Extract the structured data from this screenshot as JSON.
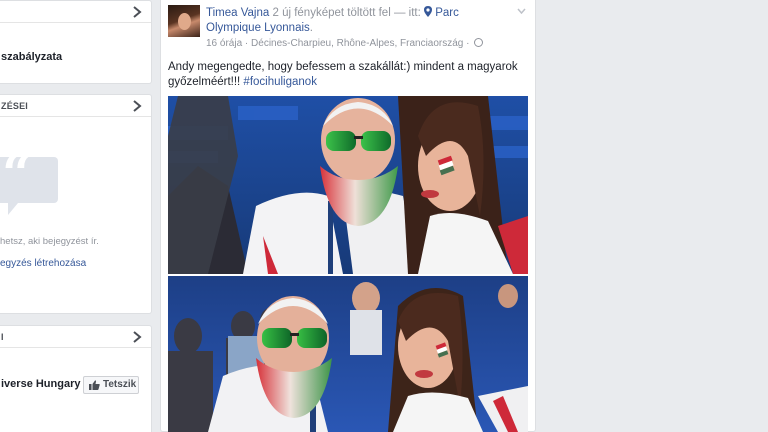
{
  "left_panel": {
    "card1": {
      "title": "szabályzata"
    },
    "card2": {
      "header": "ZÉSEI",
      "message": "hetsz, aki bejegyzést ír.",
      "link": "egyzés létrehozása"
    },
    "card3": {
      "header": "I",
      "page_name": "iverse Hungary",
      "like_button": "Tetszik"
    }
  },
  "post": {
    "author": "Timea Vajna",
    "action": " 2 új fényképet töltött fel — itt: ",
    "place_line1": "Parc",
    "place_line2": "Olympique Lyonnais",
    "place_suffix": ".",
    "time": "16 órája",
    "location": "Décines-Charpieu, Rhône-Alpes, Franciaország",
    "separator": "·",
    "text": "Andy megengedte, hogy befessem a szakállát:) mindent a magyarok győzelméért!!! ",
    "hashtag": "#focihuliganok",
    "photos": [
      "photo-1",
      "photo-2"
    ]
  },
  "colors": {
    "facebook_blue": "#365899",
    "background": "#e9ebee",
    "hungary_red": "#ce2939",
    "hungary_green": "#477050"
  },
  "icons": [
    "chevron-right-icon",
    "quote-icon",
    "thumbs-up-icon",
    "location-pin-icon",
    "globe-icon",
    "caret-down-icon"
  ]
}
